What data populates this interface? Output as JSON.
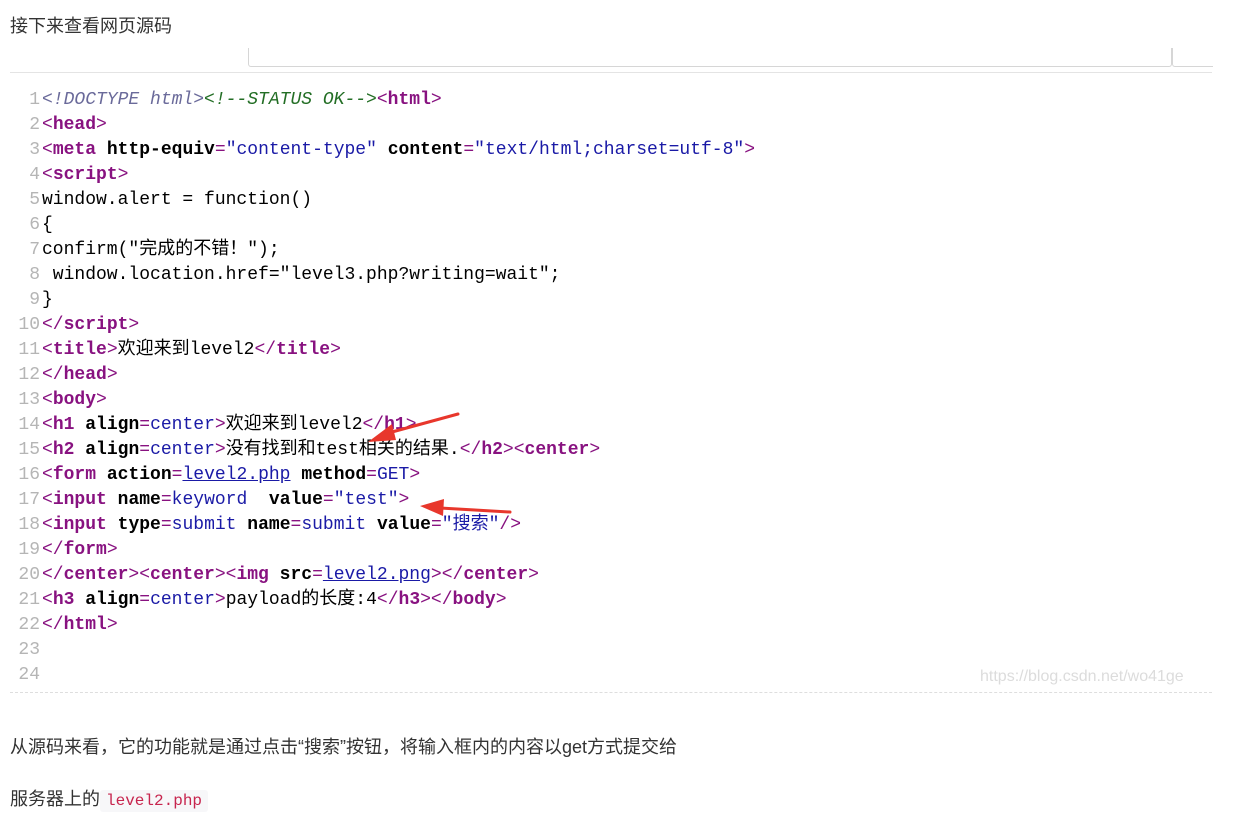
{
  "intro_text": "接下来查看网页源码",
  "code": {
    "line_numbers": [
      "1",
      "2",
      "3",
      "4",
      "5",
      "6",
      "7",
      "8",
      "9",
      "10",
      "11",
      "12",
      "13",
      "14",
      "15",
      "16",
      "17",
      "18",
      "19",
      "20",
      "21",
      "22",
      "23",
      "24"
    ],
    "l1": {
      "doctype": "<!DOCTYPE html>",
      "comment": "<!--STATUS OK-->",
      "open": "<",
      "tag": "html",
      "close": ">"
    },
    "l2": {
      "open": "<",
      "tag": "head",
      "close": ">"
    },
    "l3": {
      "open": "<",
      "tag": "meta",
      "a1": "http-equiv",
      "eq1": "=",
      "v1": "\"content-type\"",
      "a2": "content",
      "eq2": "=",
      "v2": "\"text/html;charset=utf-8\"",
      "close": ">"
    },
    "l4": {
      "open": "<",
      "tag": "script",
      "close": ">"
    },
    "l5": "window.alert = function()",
    "l6": "{",
    "l7": "confirm(\"完成的不错！\");",
    "l8": " window.location.href=\"level3.php?writing=wait\";",
    "l9": "}",
    "l10": {
      "open": "</",
      "tag": "script",
      "close": ">"
    },
    "l11": {
      "open": "<",
      "tag": "title",
      "close": ">",
      "text": "欢迎来到level2",
      "open2": "</",
      "tag2": "title",
      "close2": ">"
    },
    "l12": {
      "open": "</",
      "tag": "head",
      "close": ">"
    },
    "l13": {
      "open": "<",
      "tag": "body",
      "close": ">"
    },
    "l14": {
      "open": "<",
      "tag": "h1",
      "attr": "align",
      "eq": "=",
      "val": "center",
      "close": ">",
      "text": "欢迎来到level2",
      "open2": "</",
      "tag2": "h1",
      "close2": ">"
    },
    "l15": {
      "open": "<",
      "tag": "h2",
      "attr": "align",
      "eq": "=",
      "val": "center",
      "close": ">",
      "text": "没有找到和test相关的结果.",
      "open2": "</",
      "tag2": "h2",
      "close2": "><",
      "tag3": "center",
      "close3": ">"
    },
    "l16": {
      "open": "<",
      "tag": "form",
      "a1": "action",
      "eq1": "=",
      "v1": "level2.php",
      "a2": "method",
      "eq2": "=",
      "v2": "GET",
      "close": ">"
    },
    "l17": {
      "open": "<",
      "tag": "input",
      "a1": "name",
      "eq1": "=",
      "v1": "keyword",
      "sp": "  ",
      "a2": "value",
      "eq2": "=",
      "v2": "\"test\"",
      "close": ">"
    },
    "l18": {
      "open": "<",
      "tag": "input",
      "a1": "type",
      "eq1": "=",
      "v1": "submit",
      "a2": "name",
      "eq2": "=",
      "v2": "submit",
      "a3": "value",
      "eq3": "=",
      "q1": "\"",
      "v3": "搜索",
      "q2": "\"",
      "close": "/>"
    },
    "l19": {
      "open": "</",
      "tag": "form",
      "close": ">"
    },
    "l20": {
      "open": "</",
      "tag": "center",
      "close": "><",
      "tag2": "center",
      "close2": "><",
      "tag3": "img",
      "a1": "src",
      "eq1": "=",
      "v1": "level2.png",
      "close3": "></",
      "tag4": "center",
      "close4": ">"
    },
    "l21": {
      "open": "<",
      "tag": "h3",
      "attr": "align",
      "eq": "=",
      "val": "center",
      "close": ">",
      "text": "payload的长度:4",
      "open2": "</",
      "tag2": "h3",
      "close2": "></",
      "tag3": "body",
      "close3": ">"
    },
    "l22": {
      "open": "</",
      "tag": "html",
      "close": ">"
    }
  },
  "watermark": "https://blog.csdn.net/wo41ge",
  "paragraph1": "从源码来看，它的功能就是通过点击“搜索”按钮，将输入框内的内容以get方式提交给",
  "paragraph2_prefix": "服务器上的",
  "paragraph2_code": "level2.php",
  "colors": {
    "line_number": "#b5b5b5",
    "tag": "#881280",
    "attr_value": "#1a1aa6",
    "comment": "#236e25",
    "annotation_arrow": "#e8372c"
  }
}
